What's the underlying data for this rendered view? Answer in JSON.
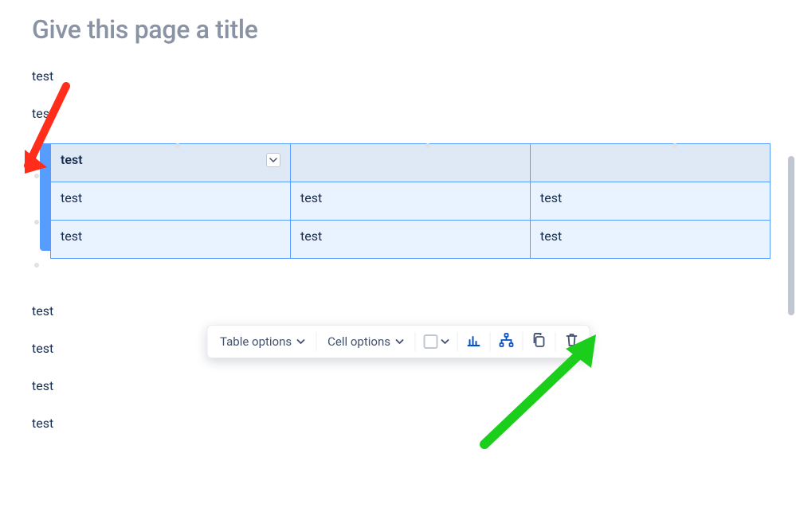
{
  "title_placeholder": "Give this page a title",
  "lines_before": [
    "test",
    "test"
  ],
  "table": {
    "header": [
      "test",
      "",
      ""
    ],
    "rows": [
      [
        "test",
        "test",
        "test"
      ],
      [
        "test",
        "test",
        "test"
      ]
    ]
  },
  "lines_after": [
    "test",
    "test",
    "test",
    "test"
  ],
  "toolbar": {
    "table_options": "Table options",
    "cell_options": "Cell options"
  }
}
